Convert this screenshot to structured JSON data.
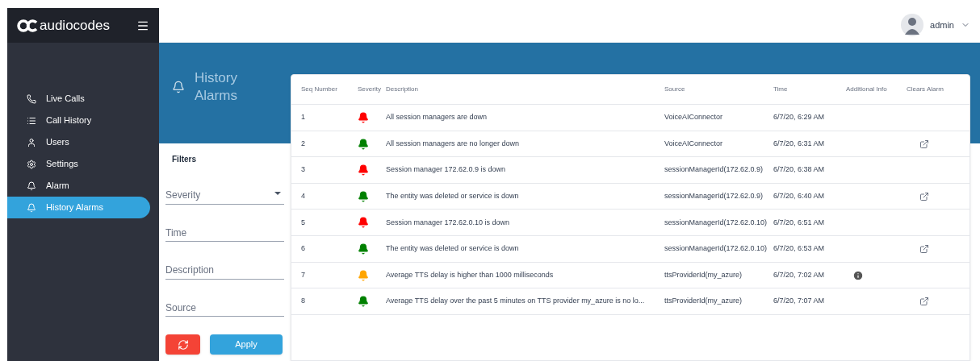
{
  "brand": {
    "logo": "audiocodes"
  },
  "user": {
    "name": "admin"
  },
  "sidebar": {
    "items": [
      {
        "label": "Live Calls",
        "selected": false
      },
      {
        "label": "Call History",
        "selected": false
      },
      {
        "label": "Users",
        "selected": false
      },
      {
        "label": "Settings",
        "selected": false
      },
      {
        "label": "Alarm",
        "selected": false
      },
      {
        "label": "History Alarms",
        "selected": true
      }
    ]
  },
  "page": {
    "title": "History Alarms"
  },
  "filters": {
    "title": "Filters",
    "fields": [
      {
        "placeholder": "Severity",
        "kind": "select"
      },
      {
        "placeholder": "Time",
        "kind": "text"
      },
      {
        "placeholder": "Description",
        "kind": "text"
      },
      {
        "placeholder": "Source",
        "kind": "text"
      }
    ],
    "apply": "Apply"
  },
  "table": {
    "columns": [
      "Seq Number",
      "Severity",
      "Description",
      "Source",
      "Time",
      "Additional Info",
      "Clears Alarm"
    ],
    "rows": [
      {
        "seq": "1",
        "color": "#ff0000",
        "description": "All session managers are down",
        "source": "VoiceAIConnector",
        "time": "6/7/20, 6:29 AM",
        "info": false,
        "clears": false
      },
      {
        "seq": "2",
        "color": "#008000",
        "description": "All session managers are no longer down",
        "source": "VoiceAIConnector",
        "time": "6/7/20, 6:31 AM",
        "info": false,
        "clears": true
      },
      {
        "seq": "3",
        "color": "#ff0000",
        "description": "Session manager 172.62.0.9 is down",
        "source": "sessionManagerId(172.62.0.9)",
        "time": "6/7/20, 6:38 AM",
        "info": false,
        "clears": false
      },
      {
        "seq": "4",
        "color": "#008000",
        "description": "The entity was deleted or service is down",
        "source": "sessionManagerId(172.62.0.9)",
        "time": "6/7/20, 6:40 AM",
        "info": false,
        "clears": true
      },
      {
        "seq": "5",
        "color": "#ff0000",
        "description": "Session manager 172.62.0.10 is down",
        "source": "sessionManagerId(172.62.0.10)",
        "time": "6/7/20, 6:51 AM",
        "info": false,
        "clears": false
      },
      {
        "seq": "6",
        "color": "#008000",
        "description": "The entity was deleted or service is down",
        "source": "sessionManagerId(172.62.0.10)",
        "time": "6/7/20, 6:53 AM",
        "info": false,
        "clears": true
      },
      {
        "seq": "7",
        "color": "#ffa500",
        "description": "Average TTS delay is higher than 1000 milliseconds",
        "source": "ttsProviderId(my_azure)",
        "time": "6/7/20, 7:02 AM",
        "info": true,
        "clears": false
      },
      {
        "seq": "8",
        "color": "#008000",
        "description": "Average TTS delay over the past 5 minutes on TTS provider my_azure is no lo...",
        "source": "ttsProviderId(my_azure)",
        "time": "6/7/20, 7:07 AM",
        "info": false,
        "clears": true
      }
    ]
  }
}
